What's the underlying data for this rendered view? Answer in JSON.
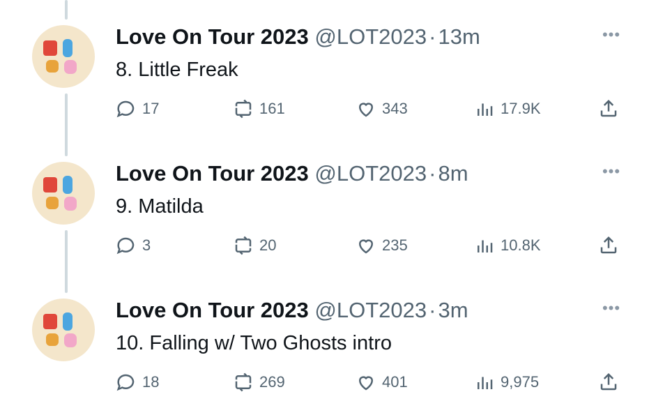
{
  "tweets": [
    {
      "name": "Love On Tour 2023",
      "handle": "@LOT2023",
      "separator": "·",
      "time": "13m",
      "text": "8. Little Freak",
      "replies": "17",
      "retweets": "161",
      "likes": "343",
      "views": "17.9K"
    },
    {
      "name": "Love On Tour 2023",
      "handle": "@LOT2023",
      "separator": "·",
      "time": "8m",
      "text": "9. Matilda",
      "replies": "3",
      "retweets": "20",
      "likes": "235",
      "views": "10.8K"
    },
    {
      "name": "Love On Tour 2023",
      "handle": "@LOT2023",
      "separator": "·",
      "time": "3m",
      "text": "10. Falling w/ Two Ghosts intro",
      "replies": "18",
      "retweets": "269",
      "likes": "401",
      "views": "9,975"
    }
  ],
  "icons": {
    "more": "more-icon",
    "reply": "reply-icon",
    "retweet": "retweet-icon",
    "like": "heart-icon",
    "views": "views-icon",
    "share": "share-icon"
  },
  "colors": {
    "text": "#0f1419",
    "secondary": "#536471",
    "thread_line": "#cfd9de",
    "avatar_bg": "#f4e6cb"
  }
}
